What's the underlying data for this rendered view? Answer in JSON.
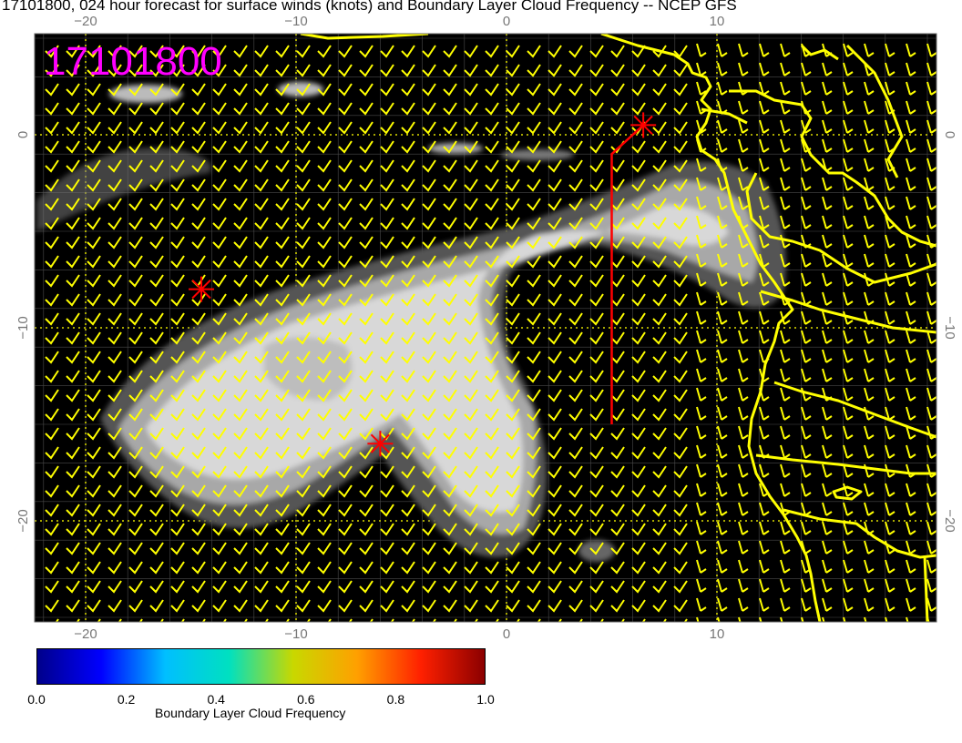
{
  "title": "17101800, 024 hour forecast for surface winds (knots) and Boundary Layer Cloud Frequency -- NCEP GFS",
  "stamp": "17101800",
  "lon_ticks": [
    "−20",
    "−10",
    "0",
    "10"
  ],
  "lat_ticks": [
    "0",
    "−10",
    "−20"
  ],
  "colorbar": {
    "label": "Boundary Layer Cloud Frequency",
    "ticks": [
      "0.0",
      "0.2",
      "0.4",
      "0.6",
      "0.8",
      "1.0"
    ],
    "colors": [
      "#00008b",
      "#0000ff",
      "#00bfff",
      "#00e0c0",
      "#c8d800",
      "#ffa000",
      "#ff2000",
      "#8b0000"
    ]
  },
  "colors": {
    "land": "#000000",
    "coast": "#ffff00",
    "barbs": "#ffff00",
    "cloud": "#d8d8d8",
    "markers": "#ff0000",
    "stamp": "#ff00ff"
  },
  "markers": [
    {
      "name": "star-northeast",
      "lon": 6.5,
      "lat": 0.5
    },
    {
      "name": "star-west",
      "lon": -14.5,
      "lat": -8
    },
    {
      "name": "star-south",
      "lon": -6,
      "lat": -16
    }
  ],
  "flight_track": [
    [
      5,
      -15
    ],
    [
      5,
      -1
    ],
    [
      6.5,
      0.5
    ]
  ]
}
